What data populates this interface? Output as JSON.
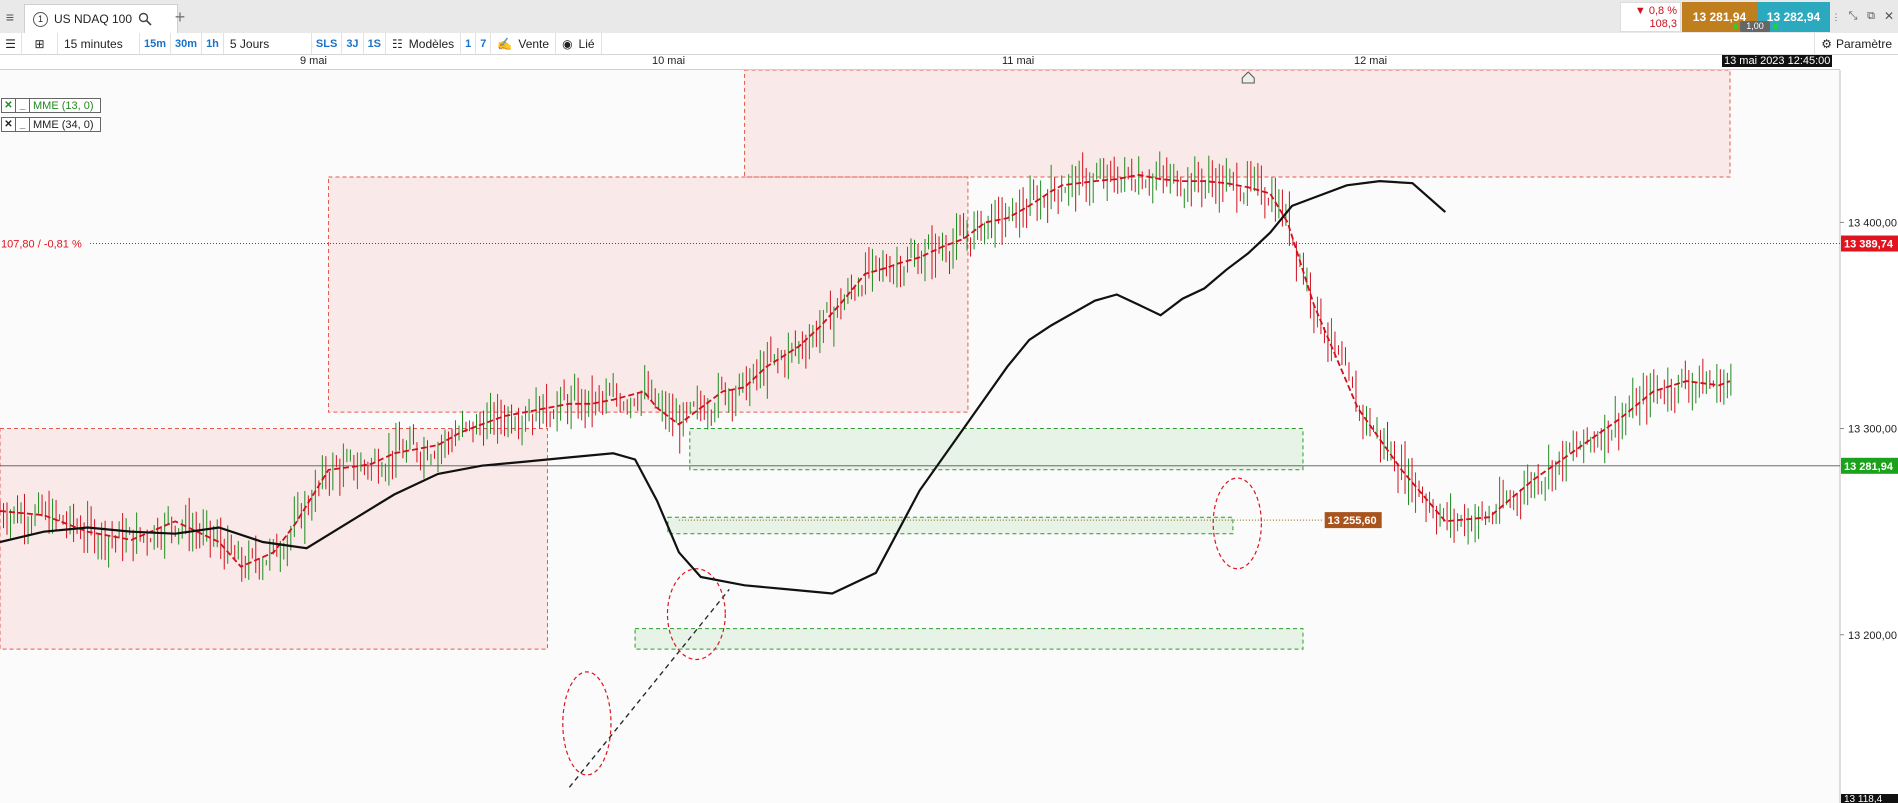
{
  "tab": {
    "badge": "1",
    "title": "US NDAQ 100"
  },
  "quote": {
    "change_pct": "▼ 0,8 %",
    "change_abs": "108,3",
    "bid": "13 281,94",
    "ask": "13 282,94",
    "spread": "1,00"
  },
  "toolbar": {
    "timeframe": "15 minutes",
    "tf_buttons": [
      "15m",
      "30m",
      "1h"
    ],
    "period": "5 Jours",
    "period_buttons": [
      "SLS",
      "3J",
      "1S"
    ],
    "models": "Modèles",
    "num_buttons": [
      "1",
      "7"
    ],
    "sell": "Vente",
    "linked": "Lié",
    "params": "Paramètre"
  },
  "legend": [
    "MME (13, 0)",
    "MME (34, 0)"
  ],
  "chart_data": {
    "type": "line",
    "instrument": "US NDAQ 100",
    "interval": "15 minutes",
    "x_labels": [
      "9 mai",
      "10 mai",
      "11 mai",
      "12 mai"
    ],
    "cursor_time": "13 mai 2023 12:45:00",
    "y_ticks": [
      13400,
      13300,
      13200
    ],
    "y_tick_labels": [
      "13 400,00",
      "13 300,00",
      "13 200,00"
    ],
    "y_range": [
      13118.4,
      13473.9
    ],
    "partial_bottom_label": "13 118,4",
    "ref_line": {
      "value": 13389.74,
      "label": "107,80 / -0,81 %",
      "tag": "13 389,74",
      "color": "#e0141e"
    },
    "current": {
      "value": 13281.94,
      "tag": "13 281,94",
      "color": "#1aa31a"
    },
    "level": {
      "value": 13255.6,
      "tag": "13 255,60",
      "color": "#a8541c"
    },
    "series": [
      {
        "name": "MME (13, 0)",
        "color": "#d0101c",
        "color_rising": "#1f8a1f",
        "x": [
          0,
          20,
          40,
          60,
          80,
          100,
          110,
          125,
          135,
          150,
          165,
          170,
          180,
          190,
          200,
          210,
          220,
          230,
          240,
          250,
          260,
          270,
          280,
          287,
          294,
          300,
          310,
          320,
          330,
          340,
          350,
          365,
          375,
          385,
          395,
          405,
          410,
          420,
          430,
          440,
          450,
          460,
          470,
          480,
          485,
          500,
          510,
          520,
          530,
          540,
          550,
          560,
          570,
          580,
          588,
          600,
          620,
          640,
          660,
          680,
          700,
          720,
          740,
          755,
          770,
          785,
          790
        ],
        "values": [
          13260,
          13258,
          13250,
          13246,
          13255,
          13245,
          13233,
          13240,
          13254,
          13280,
          13282,
          13283,
          13288,
          13290,
          13292,
          13298,
          13302,
          13306,
          13308,
          13310,
          13312,
          13312,
          13314,
          13316,
          13318,
          13310,
          13302,
          13310,
          13318,
          13320,
          13330,
          13340,
          13350,
          13362,
          13375,
          13378,
          13380,
          13383,
          13388,
          13392,
          13400,
          13402,
          13408,
          13415,
          13418,
          13420,
          13421,
          13423,
          13421,
          13420,
          13420,
          13419,
          13417,
          13414,
          13400,
          13360,
          13310,
          13280,
          13255,
          13257,
          13275,
          13290,
          13305,
          13318,
          13323,
          13321,
          13323
        ]
      },
      {
        "name": "MME (34, 0)",
        "color": "#111111",
        "x": [
          0,
          20,
          40,
          60,
          80,
          100,
          120,
          140,
          160,
          180,
          200,
          220,
          240,
          260,
          280,
          290,
          300,
          310,
          320,
          340,
          360,
          380,
          400,
          420,
          440,
          460,
          470,
          480,
          490,
          500,
          510,
          520,
          530,
          540,
          550,
          560,
          570,
          580,
          590,
          600,
          615,
          630,
          645,
          660
        ],
        "values": [
          13245,
          13250,
          13252,
          13250,
          13249,
          13252,
          13245,
          13242,
          13255,
          13268,
          13278,
          13282,
          13284,
          13286,
          13288,
          13285,
          13265,
          13240,
          13228,
          13224,
          13222,
          13220,
          13230,
          13270,
          13300,
          13330,
          13343,
          13350,
          13356,
          13362,
          13365,
          13360,
          13355,
          13363,
          13368,
          13377,
          13385,
          13395,
          13408,
          13412,
          13418,
          13420,
          13419,
          13405
        ]
      }
    ],
    "zones": [
      {
        "type": "resistance",
        "x0": 340,
        "x1": 790,
        "y0": 13422,
        "y1": 13473.9
      },
      {
        "type": "resistance",
        "x0": 150,
        "x1": 442,
        "y0": 13308,
        "y1": 13422
      },
      {
        "type": "resistance",
        "x0": 0,
        "x1": 250,
        "y0": 13193,
        "y1": 13300
      },
      {
        "type": "support",
        "x0": 315,
        "x1": 595,
        "y0": 13280,
        "y1": 13300
      },
      {
        "type": "support",
        "x0": 305,
        "x1": 563,
        "y0": 13249,
        "y1": 13257
      },
      {
        "type": "support",
        "x0": 290,
        "x1": 595,
        "y0": 13193,
        "y1": 13203
      }
    ],
    "ellipses": [
      {
        "x": 268,
        "y": 13157,
        "rx": 5,
        "ry": 25
      },
      {
        "x": 318,
        "y": 13210,
        "rx": 6,
        "ry": 22
      },
      {
        "x": 565,
        "y": 13254,
        "rx": 5,
        "ry": 22
      }
    ],
    "trendline": {
      "x0": 260,
      "y0": 13126,
      "x1": 333,
      "y1": 13222
    }
  }
}
